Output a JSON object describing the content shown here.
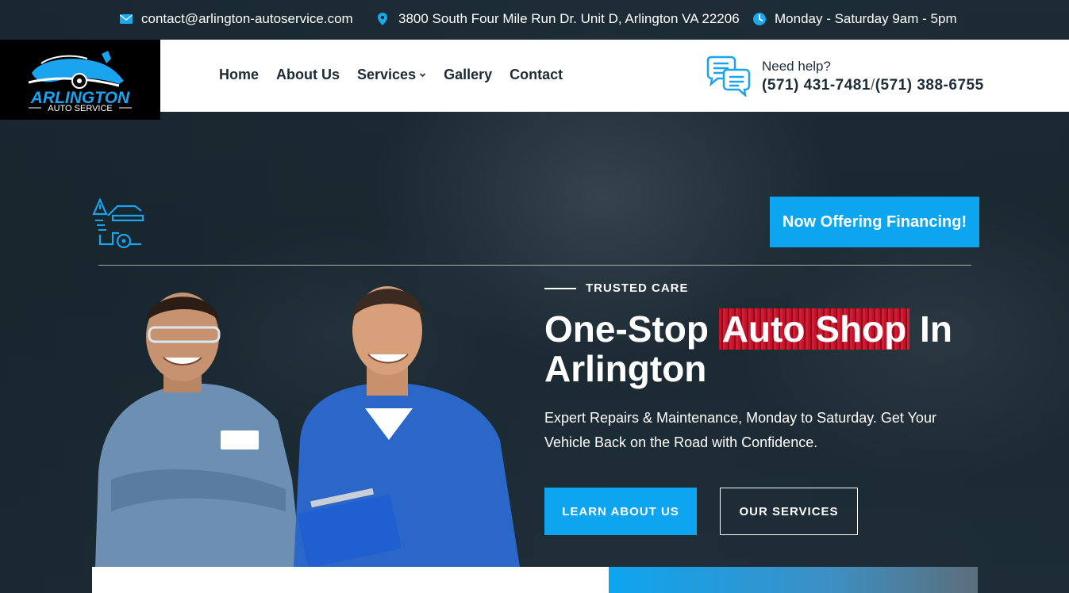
{
  "topbar": {
    "email": "contact@arlington-autoservice.com",
    "address": "3800 South Four Mile Run Dr. Unit D, Arlington VA 22206",
    "hours": "Monday - Saturday 9am - 5pm"
  },
  "logo": {
    "line1": "ARLINGTON",
    "line2": "AUTO SERVICE"
  },
  "nav": {
    "items": [
      "Home",
      "About Us",
      "Services",
      "Gallery",
      "Contact"
    ]
  },
  "help": {
    "label": "Need help?",
    "phone1": "(571) 431-7481",
    "separator": "/",
    "phone2": "(571) 388-6755"
  },
  "hero": {
    "financing_button": "Now Offering Financing!",
    "eyebrow": "TRUSTED CARE",
    "headline_part1": "One-Stop ",
    "headline_highlight": "Auto Shop",
    "headline_part2": " In Arlington",
    "subtext": "Expert Repairs & Maintenance, Monday to Saturday. Get Your Vehicle Back on the Road with Confidence.",
    "primary_button": "LEARN ABOUT US",
    "secondary_button": "OUR SERVICES"
  },
  "colors": {
    "accent": "#0ea5f0",
    "dark": "#1d2b36",
    "highlight": "#c4122b"
  },
  "icons": {
    "email": "envelope-icon",
    "address": "map-pin-icon",
    "hours": "clock-icon",
    "help": "chat-bubbles-icon",
    "services_dropdown": "chevron-down-icon",
    "hero_badge": "car-repair-icon"
  }
}
